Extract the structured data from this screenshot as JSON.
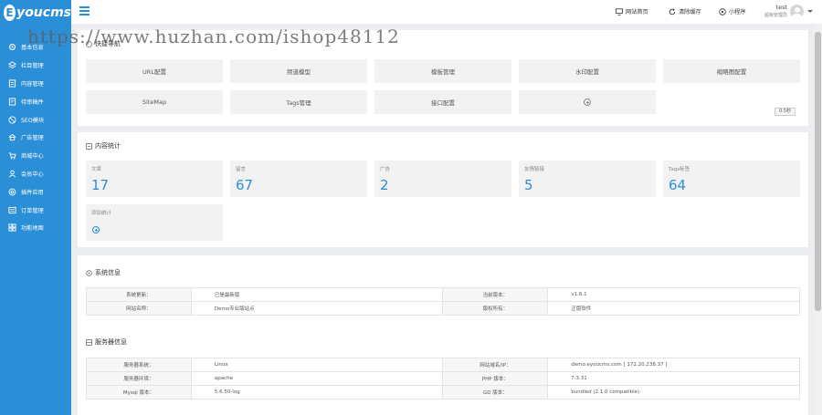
{
  "logo": {
    "mark": "E",
    "text": "youcms"
  },
  "sidebar": {
    "items": [
      {
        "label": "基本信息",
        "icon": "gear-icon"
      },
      {
        "label": "栏目管理",
        "icon": "layers-icon"
      },
      {
        "label": "内容管理",
        "icon": "document-icon"
      },
      {
        "label": "待审稿件",
        "icon": "pending-icon"
      },
      {
        "label": "SEO模块",
        "icon": "seo-icon"
      },
      {
        "label": "广告管理",
        "icon": "ad-icon"
      },
      {
        "label": "商城中心",
        "icon": "cart-icon"
      },
      {
        "label": "会员中心",
        "icon": "user-icon"
      },
      {
        "label": "插件应用",
        "icon": "plugin-icon"
      },
      {
        "label": "订单管理",
        "icon": "order-icon"
      },
      {
        "label": "功能地图",
        "icon": "map-icon"
      }
    ]
  },
  "topbar": {
    "home_label": "网站首页",
    "clear_cache_label": "清除缓存",
    "miniprogram_label": "小程序",
    "user_name": "test",
    "user_role": "超级管理员"
  },
  "watermark": "https://www.huzhan.com/ishop48112",
  "quick_nav": {
    "title": "快捷导航",
    "buttons": [
      "URL配置",
      "频道模型",
      "模板管理",
      "水印配置",
      "缩略图配置",
      "SiteMap",
      "Tags管理",
      "接口配置"
    ],
    "small_badge": "0.5秒"
  },
  "content_stats": {
    "title": "内容统计",
    "items": [
      {
        "label": "文章",
        "value": "17"
      },
      {
        "label": "留言",
        "value": "67"
      },
      {
        "label": "广告",
        "value": "2"
      },
      {
        "label": "友情链接",
        "value": "5"
      },
      {
        "label": "Tags标签",
        "value": "64"
      }
    ],
    "add_label": "添加统计"
  },
  "system_info": {
    "title": "系统信息",
    "rows": [
      [
        "系统更新：",
        "已是最新版",
        "当前版本：",
        "v1.6.1"
      ],
      [
        "网站名称：",
        "Demo专业版站点",
        "版权所有：",
        "正版软件"
      ]
    ]
  },
  "server_info": {
    "title": "服务器信息",
    "rows": [
      [
        "服务器系统：",
        "Linux",
        "网站域名/IP：",
        "demo.eyoucms.com [ 172.20.238.37 ]"
      ],
      [
        "服务器环境：",
        "apache",
        "PHP 版本：",
        "7.3.31"
      ],
      [
        "Mysql 版本：",
        "5.6.50-log",
        "GD 版本：",
        "bundled (2.1.0 compatible)"
      ]
    ]
  },
  "colors": {
    "primary": "#2b8fd8",
    "background": "#ecedf0",
    "panel": "#ffffff",
    "tile": "#f2f2f2"
  }
}
